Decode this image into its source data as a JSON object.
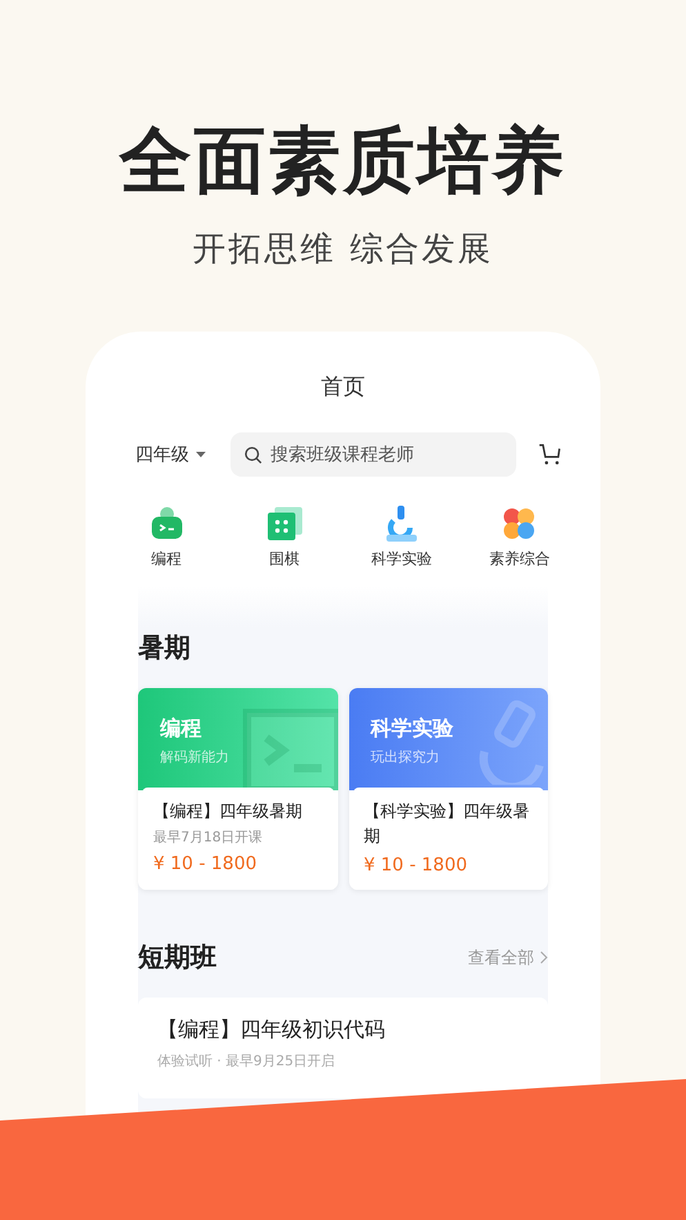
{
  "headline": "全面素质培养",
  "subtitle": "开拓思维 综合发展",
  "screen": {
    "title": "首页",
    "grade": "四年级",
    "search": {
      "placeholder": "搜索班级课程老师"
    },
    "categories": [
      {
        "label": "编程",
        "kind": "robot"
      },
      {
        "label": "围棋",
        "kind": "board"
      },
      {
        "label": "科学实验",
        "kind": "microscope"
      },
      {
        "label": "素养综合",
        "kind": "petals"
      }
    ],
    "summer": {
      "title": "暑期",
      "courses": [
        {
          "kind": "coding",
          "banner_title": "编程",
          "banner_subtitle": "解码新能力",
          "name": "【编程】四年级暑期",
          "date": "最早7月18日开课",
          "price": "¥ 10 - 1800"
        },
        {
          "kind": "science",
          "banner_title": "科学实验",
          "banner_subtitle": "玩出探究力",
          "name": "【科学实验】四年级暑期",
          "price": "¥ 10 - 1800"
        }
      ]
    },
    "short": {
      "title": "短期班",
      "view_all": "查看全部",
      "courses": [
        {
          "name": "【编程】四年级初识代码",
          "meta": "体验试听 · 最早9月25日开启"
        }
      ]
    }
  }
}
